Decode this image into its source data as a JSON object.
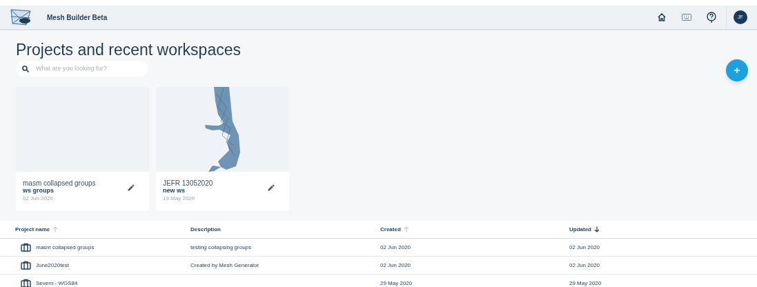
{
  "header": {
    "app_name": "Mesh Builder Beta",
    "avatar": "JF"
  },
  "page_title": "Projects and recent workspaces",
  "search": {
    "placeholder": "What are you looking for?"
  },
  "workspaces": [
    {
      "project": "masm collapsed groups",
      "name": "ws groups",
      "date": "02 Jun 2020",
      "has_preview": false
    },
    {
      "project": "JEFR 13052020",
      "name": "new ws",
      "date": "19 May 2020",
      "has_preview": true
    }
  ],
  "table": {
    "columns": [
      {
        "label": "Project name",
        "sortable": true,
        "descending": false,
        "active": false
      },
      {
        "label": "Description",
        "sortable": false
      },
      {
        "label": "Created",
        "sortable": true,
        "descending": false,
        "active": false
      },
      {
        "label": "Updated",
        "sortable": true,
        "descending": true,
        "active": true
      }
    ],
    "rows": [
      {
        "name": "masm collapsed groups",
        "description": "testing collapsing groups",
        "created": "02 Jun 2020",
        "updated": "02 Jun 2020"
      },
      {
        "name": "June2020test",
        "description": "Created by Mesh Generator",
        "created": "02 Jun 2020",
        "updated": "02 Jun 2020"
      },
      {
        "name": "Severn - WGS84",
        "created": "29 May 2020",
        "updated": "29 May 2020"
      }
    ]
  }
}
